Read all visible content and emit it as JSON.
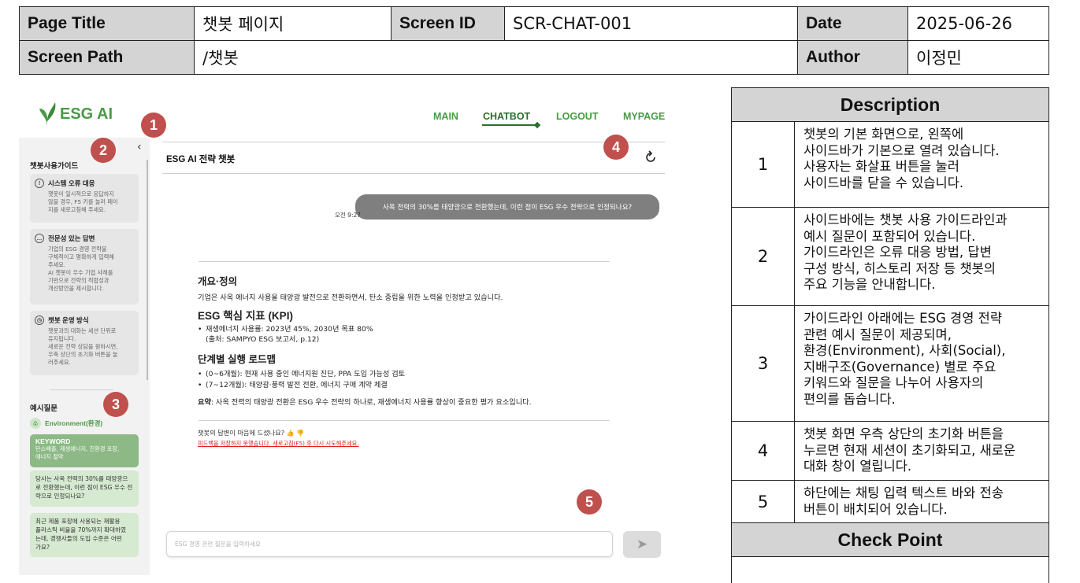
{
  "header": {
    "page_title_label": "Page Title",
    "page_title_value": "챗봇 페이지",
    "screen_id_label": "Screen ID",
    "screen_id_value": "SCR-CHAT-001",
    "date_label": "Date",
    "date_value": "2025-06-26",
    "screen_path_label": "Screen Path",
    "screen_path_value": "/챗봇",
    "author_label": "Author",
    "author_value": "이정민"
  },
  "description": {
    "title": "Description",
    "rows": [
      {
        "num": "1",
        "text": "챗봇의 기본 화면으로, 왼쪽에\n사이드바가 기본으로 열려 있습니다.\n사용자는 화살표 버튼을 눌러\n사이드바를 닫을 수 있습니다."
      },
      {
        "num": "2",
        "text": "사이드바에는 챗봇 사용 가이드라인과\n예시 질문이 포함되어 있습니다.\n가이드라인은 오류 대응 방법, 답변\n구성 방식, 히스토리 저장 등 챗봇의\n주요 기능을 안내합니다."
      },
      {
        "num": "3",
        "text": "가이드라인 아래에는 ESG 경영 전략\n관련 예시 질문이 제공되며,\n환경(Environment), 사회(Social),\n지배구조(Governance) 별로 주요\n키워드와 질문을 나누어 사용자의\n편의를 돕습니다."
      },
      {
        "num": "4",
        "text": "챗봇 화면 우측 상단의 초기화 버튼을\n누르면 현재 세션이 초기화되고, 새로운\n대화 창이 열립니다."
      },
      {
        "num": "5",
        "text": "하단에는 채팅 입력 텍스트 바와 전송\n버튼이 배치되어 있습니다."
      }
    ],
    "checkpoint_title": "Check Point"
  },
  "mockup": {
    "logo_text": "ESG AI",
    "nav": {
      "main": "MAIN",
      "chatbot": "CHATBOT",
      "logout": "LOGOUT",
      "mypage": "MYPAGE"
    },
    "markers": [
      "1",
      "2",
      "3",
      "4",
      "5"
    ],
    "collapse_glyph": "‹",
    "sidebar": {
      "guide_title": "챗봇사용가이드",
      "guides": [
        {
          "icon": "warning-icon",
          "glyph": "!",
          "title": "시스템 오류 대응",
          "body": "챗봇이 일시적으로 응답하지\n않을 경우, F5 키를 눌러 페이\n지를 새로고침해 주세요."
        },
        {
          "icon": "chat-icon",
          "glyph": "…",
          "title": "전문성 있는 답변",
          "body": "기업의 ESG 경영 전략을\n구체적이고 명확하게 입력해\n주세요.\nAI 챗봇이 우수 기업 사례를\n기반으로 전략의 적합성과\n개선방안을 제시합니다."
        },
        {
          "icon": "clock-icon",
          "glyph": "◷",
          "title": "챗봇 운영 방식",
          "body": "챗봇과의 대화는 세션 단위로\n유지됩니다.\n새로운 전략 상담을 원하시면,\n우측 상단의 초기화 버튼을 눌\n러주세요."
        }
      ],
      "example_title": "예시질문",
      "env_label": "Environment(환경)",
      "keyword_title": "KEYWORD",
      "keyword_body": "탄소배출, 재생에너지, 친환경 포장,\n에너지 절약",
      "questions": [
        "당사는 사옥 전력의 30%를 태양광으\n로 전환했는데, 이런 점이 ESG 우수 전\n략으로 인정되나요?",
        "최근 제품 포장에 사용되는 재활용\n플라스틱 비율을 70%까지 확대하였\n는데, 경쟁사들의 도입 수준은 어떤\n가요?"
      ]
    },
    "chat": {
      "title": "ESG AI 전략 챗봇",
      "time": "오전 9:27",
      "user_message": "사옥 전력의 30%를 태양광으로 전환했는데, 이런 점이 ESG 우수 전략으로 인정되나요?",
      "answer": {
        "sec1_title": "개요·정의",
        "sec1_body": "기업은 사옥 에너지 사용을 태양광 발전으로 전환하면서, 탄소 중립을 위한 노력을 인정받고 있습니다.",
        "kpi_title": "ESG 핵심 지표 (KPI)",
        "kpi_items": [
          "재생에너지 사용률: 2023년 45%, 2030년 목표 80%",
          "(출처: SAMPYO ESG 보고서, p.12)"
        ],
        "roadmap_title": "단계별 실행 로드맵",
        "roadmap_items": [
          "(0~6개월): 현재 사용 중인 에너지원 진단, PPA 도입 가능성 검토",
          "(7~12개월): 태양광·풍력 발전 전환, 에너지 구매 계약 체결"
        ],
        "summary_label": "요약",
        "summary_body": ": 사옥 전력의 태양광 전환은 ESG 우수 전략의 하나로, 재생에너지 사용률 향상이 중요한 평가 요소입니다."
      },
      "feedback_question": "챗봇의 답변이 마음에 드셨나요?",
      "feedback_glyphs": "👍 👎",
      "feedback_error": "피드백을 저장하지 못했습니다. 새로고침(F5) 후 다시 시도해주세요.",
      "input_placeholder": "ESG 경영 관련 질문을 입력하세요",
      "send_glyph": "➤"
    }
  },
  "colors": {
    "brand_green": "#4a9a46",
    "marker_red": "#c0504d",
    "keyword_green": "#8cb985",
    "question_green": "#d6e9d1"
  }
}
